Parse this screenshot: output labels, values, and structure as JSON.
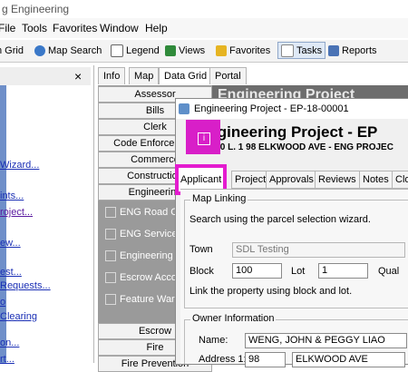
{
  "app": {
    "title": "g Engineering"
  },
  "menubar": [
    "File",
    "Tools",
    "Favorites",
    "Window",
    "Help"
  ],
  "toolbar": {
    "items": [
      {
        "label": "n Grid",
        "icon": "grid-icon"
      },
      {
        "label": "Map Search",
        "icon": "globe-icon"
      },
      {
        "label": "Legend",
        "icon": "legend-icon"
      },
      {
        "label": "Views",
        "icon": "views-icon"
      },
      {
        "label": "Favorites",
        "icon": "star-icon"
      },
      {
        "label": "Tasks",
        "icon": "tasks-icon"
      },
      {
        "label": "Reports",
        "icon": "reports-icon"
      }
    ]
  },
  "left_panel": {
    "close": "×",
    "links": [
      "Wizard...",
      "ints...",
      "roject...",
      "",
      "ew...",
      "est...",
      "Requests...",
      "o",
      "Clearing",
      "on...",
      "rt..."
    ]
  },
  "top_tabs": [
    "Info",
    "Map",
    "Data Grid",
    "Portal"
  ],
  "modules": [
    "Assessor",
    "Bills",
    "Clerk",
    "Code Enforcement",
    "Commerce",
    "Construction",
    "Engineering"
  ],
  "sub_items": [
    "ENG Road Op",
    "ENG Service R",
    "Engineering P",
    "Escrow Accou",
    "Feature Warn",
    ""
  ],
  "modules_bottom": [
    "Escrow",
    "Fire",
    "Fire Prevention"
  ],
  "background_title": "Engineering Project",
  "dialog": {
    "window_title": "Engineering Project - EP-18-00001",
    "big_title": "Engineering Project - EP",
    "subtitle": "L. 100 L. 1  98 ELKWOOD AVE - ENG PROJEC",
    "info_icon": "i",
    "tabs": [
      "Applicant",
      "Project",
      "Approvals",
      "Reviews",
      "Notes",
      "Clo"
    ],
    "map_linking": {
      "legend": "Map Linking",
      "search_text": "Search using the parcel selection wizard.",
      "town_label": "Town",
      "town_value": "SDL Testing",
      "block_label": "Block",
      "block_value": "100",
      "lot_label": "Lot",
      "lot_value": "1",
      "qual_label": "Qual",
      "link_text": "Link the property using block and lot."
    },
    "owner": {
      "legend": "Owner Information",
      "name_label": "Name:",
      "name_value": "WENG, JOHN & PEGGY LIAO",
      "address_label": "Address 1:",
      "address_num": "98",
      "address_street": "ELKWOOD AVE"
    }
  }
}
